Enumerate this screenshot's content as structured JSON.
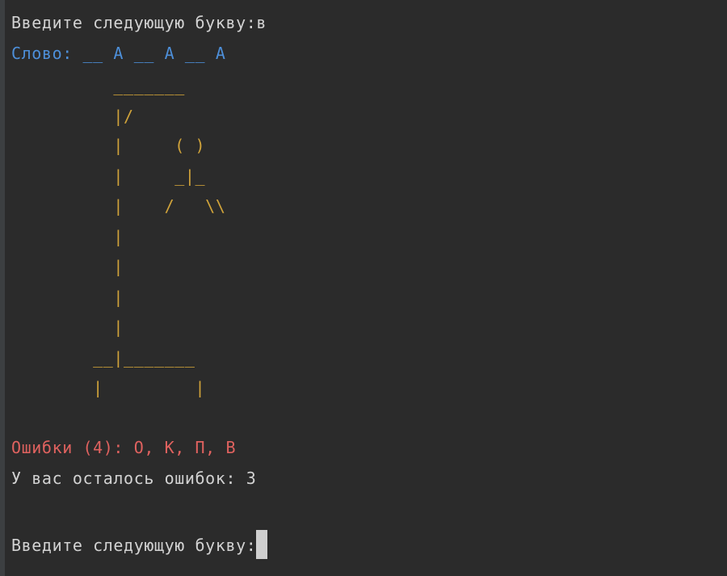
{
  "terminal": {
    "prompt_line": "Введите следующую букву:в",
    "word_line": "Слово: __ А __ А __ А",
    "gallows": [
      "          _______",
      "          |/",
      "          |     ( )",
      "          |     _|_",
      "          |    /   \\\\",
      "          |",
      "          |",
      "          |",
      "          |",
      "        __|_______",
      "        |         |"
    ],
    "errors_line": "Ошибки (4): О, К, П, В",
    "remaining_line": "У вас осталось ошибок: 3",
    "input_prompt": "Введите следующую букву:",
    "colors": {
      "background": "#2b2b2b",
      "default_text": "#d2d2d2",
      "word": "#4d8fd9",
      "gallows": "#d0a33a",
      "errors": "#e0625f"
    }
  }
}
